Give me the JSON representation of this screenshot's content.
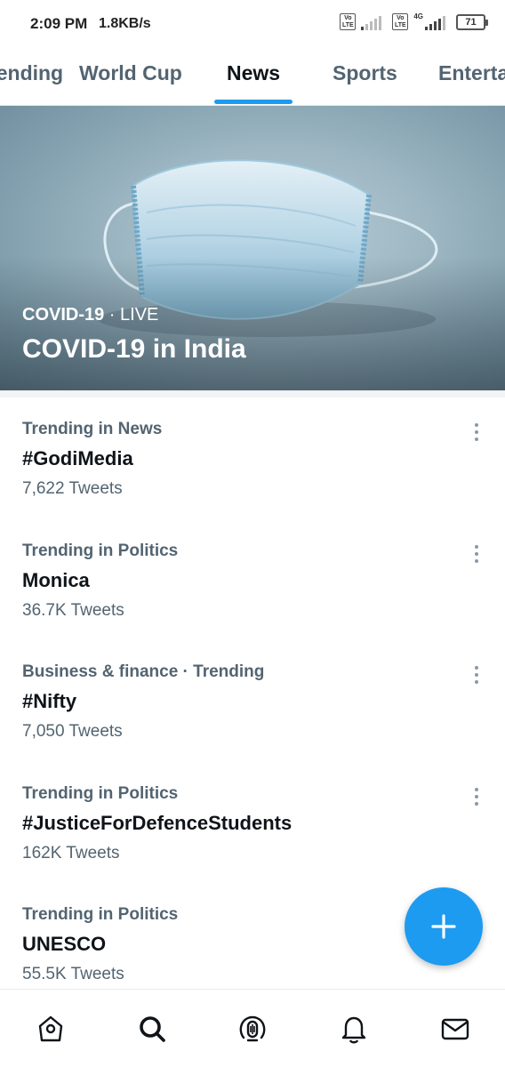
{
  "status_bar": {
    "time": "2:09 PM",
    "network_speed": "1.8KB/s",
    "volte_label": "Vo LTE",
    "network_type": "4G",
    "battery": "71"
  },
  "tabs": [
    {
      "label": "Trending",
      "active": false
    },
    {
      "label": "World Cup",
      "active": false
    },
    {
      "label": "News",
      "active": true
    },
    {
      "label": "Sports",
      "active": false
    },
    {
      "label": "Entertainment",
      "active": false
    }
  ],
  "hero": {
    "category": "COVID-19",
    "separator": " · ",
    "status": "LIVE",
    "title": "COVID-19 in India"
  },
  "trends": [
    {
      "context": "Trending in News",
      "name": "#GodiMedia",
      "count": "7,622 Tweets"
    },
    {
      "context": "Trending in Politics",
      "name": "Monica",
      "count": "36.7K Tweets"
    },
    {
      "context": "Business & finance · Trending",
      "name": "#Nifty",
      "count": "7,050 Tweets"
    },
    {
      "context": "Trending in Politics",
      "name": "#JusticeForDefenceStudents",
      "count": "162K Tweets"
    },
    {
      "context": "Trending in Politics",
      "name": "UNESCO",
      "count": "55.5K Tweets"
    }
  ],
  "fab": {
    "icon": "plus-icon"
  },
  "bottom_nav": [
    {
      "icon": "home-icon",
      "active": false
    },
    {
      "icon": "search-icon",
      "active": true
    },
    {
      "icon": "spaces-icon",
      "active": false
    },
    {
      "icon": "notifications-icon",
      "active": false
    },
    {
      "icon": "messages-icon",
      "active": false
    }
  ],
  "colors": {
    "accent": "#1d9bf0",
    "primary_text": "#0f1419",
    "secondary_text": "#536471"
  }
}
